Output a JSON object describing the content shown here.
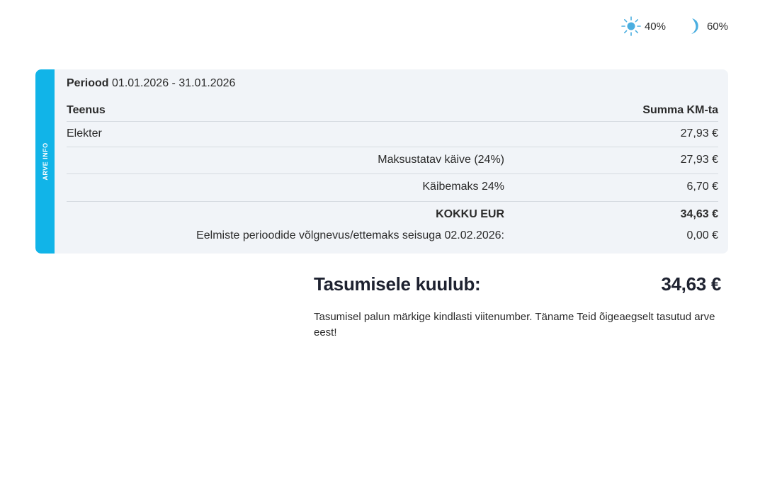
{
  "day_night": {
    "day_percent": "40%",
    "night_percent": "60%",
    "day_icon": "sun-icon",
    "night_icon": "moon-icon",
    "accent": "#4aaee0"
  },
  "card": {
    "side_label": "ARVE INFO",
    "accent": "#11b4e8",
    "period_label": "Periood",
    "period_value": "01.01.2026 - 31.01.2026",
    "col_service": "Teenus",
    "col_sum": "Summa KM-ta",
    "rows": [
      {
        "label": "Elekter",
        "mid": "",
        "amount": "27,93 €"
      },
      {
        "label": "",
        "mid": "Maksustatav käive (24%)",
        "amount": "27,93 €"
      },
      {
        "label": "",
        "mid": "Käibemaks 24%",
        "amount": "6,70 €"
      }
    ],
    "total_label": "KOKKU EUR",
    "total_amount": "34,63 €",
    "prev_label": "Eelmiste perioodide võlgnevus/ettemaks seisuga 02.02.2026:",
    "prev_amount": "0,00 €"
  },
  "payment": {
    "label": "Tasumisele kuulub:",
    "amount": "34,63 €",
    "note": "Tasumisel palun märkige kindlasti viitenumber. Täname Teid õigeaegselt tasutud arve eest!"
  }
}
